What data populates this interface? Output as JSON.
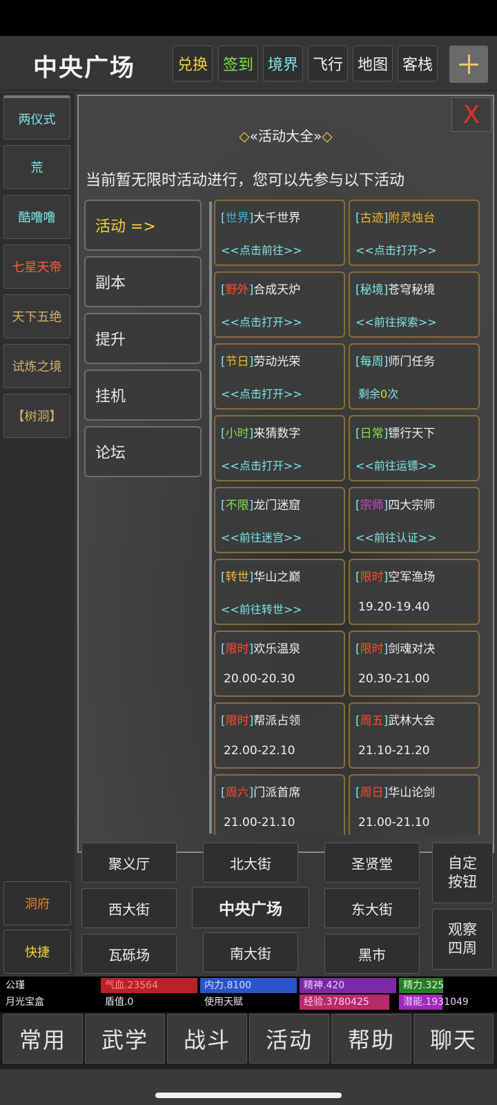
{
  "header": {
    "title": "中央广场",
    "buttons": [
      {
        "label": "兑换",
        "color": "#f2d23a"
      },
      {
        "label": "签到",
        "color": "#7ee24a"
      },
      {
        "label": "境界",
        "color": "#7fe6e6"
      },
      {
        "label": "飞行",
        "color": "#f0f0f0"
      },
      {
        "label": "地图",
        "color": "#f0f0f0"
      },
      {
        "label": "客栈",
        "color": "#f0f0f0"
      }
    ],
    "plus_icon": "plus-icon"
  },
  "sidebar": {
    "items": [
      {
        "label": "两仪式",
        "color": "#7fe6e6"
      },
      {
        "label": "荒",
        "color": "#7fe6e6"
      },
      {
        "label": "酷噜噜",
        "color": "#7fe6e6"
      },
      {
        "label": "七星天帝",
        "color": "#ff5a3a"
      },
      {
        "label": "天下五绝",
        "color": "#d8b06a"
      },
      {
        "label": "试炼之境",
        "color": "#d8b06a"
      },
      {
        "label": "【树洞】",
        "color": "#d8b06a"
      }
    ],
    "bottom": [
      {
        "label": "洞府",
        "color": "#e8842a"
      },
      {
        "label": "快捷",
        "color": "#f2d23a"
      }
    ]
  },
  "panel": {
    "close_label": "X",
    "title_left": "◇",
    "title": "«活动大全»",
    "title_right": "◇",
    "notice": "当前暂无限时活动进行，您可以先参与以下活动",
    "categories": [
      "活动 =>",
      "副本",
      "提升",
      "挂机",
      "论坛"
    ],
    "cards": [
      {
        "tag": "世界",
        "tag_color": "#3ab0e6",
        "name": "大千世界",
        "name_color": "#eeeeee",
        "action": "<<点击前往>>"
      },
      {
        "tag": "古迹",
        "tag_color": "#f0b830",
        "name": "附灵烛台",
        "name_color": "#f0b830",
        "action": "<<点击打开>>"
      },
      {
        "tag": "野外",
        "tag_color": "#ff4a2a",
        "name": "合成天炉",
        "name_color": "#eeeeee",
        "action": "<<点击打开>>"
      },
      {
        "tag": "秘境",
        "tag_color": "#7fe6e6",
        "name": "苍穹秘境",
        "name_color": "#eeeeee",
        "action": "<<前往探索>>"
      },
      {
        "tag": "节日",
        "tag_color": "#f0b830",
        "name": "劳动光荣",
        "name_color": "#eeeeee",
        "action": "<<点击打开>>"
      },
      {
        "tag": "每周",
        "tag_color": "#7fe6e6",
        "name": "师门任务",
        "name_color": "#eeeeee",
        "action_prefix": "剩余",
        "action_count": "0",
        "action_suffix": "次"
      },
      {
        "tag": "小时",
        "tag_color": "#7ee24a",
        "name": "来猜数字",
        "name_color": "#eeeeee",
        "action": "<<点击打开>>"
      },
      {
        "tag": "日常",
        "tag_color": "#7ee24a",
        "name": "镖行天下",
        "name_color": "#eeeeee",
        "action": "<<前往运镖>>"
      },
      {
        "tag": "不限",
        "tag_color": "#7ee24a",
        "name": "龙门迷窟",
        "name_color": "#eeeeee",
        "action": "<<前往迷宫>>"
      },
      {
        "tag": "宗师",
        "tag_color": "#d24ad2",
        "name": "四大宗师",
        "name_color": "#eeeeee",
        "action": "<<前往认证>>"
      },
      {
        "tag": "转世",
        "tag_color": "#f0b830",
        "name": "华山之巅",
        "name_color": "#eeeeee",
        "action": "<<前往转世>>"
      },
      {
        "tag": "限时",
        "tag_color": "#ff4a2a",
        "name": "空军渔场",
        "name_color": "#eeeeee",
        "time": "19.20-19.40"
      },
      {
        "tag": "限时",
        "tag_color": "#ff4a2a",
        "name": "欢乐温泉",
        "name_color": "#eeeeee",
        "time": "20.00-20.30"
      },
      {
        "tag": "限时",
        "tag_color": "#ff4a2a",
        "name": "剑魂对决",
        "name_color": "#eeeeee",
        "time": "20.30-21.00"
      },
      {
        "tag": "限时",
        "tag_color": "#ff4a2a",
        "name": "帮派占领",
        "name_color": "#eeeeee",
        "time": "22.00-22.10"
      },
      {
        "tag": "周五",
        "tag_color": "#ff4a2a",
        "name": "武林大会",
        "name_color": "#eeeeee",
        "time": "21.10-21.20"
      },
      {
        "tag": "周六",
        "tag_color": "#ff4a2a",
        "name": "门派首席",
        "name_color": "#eeeeee",
        "time": "21.00-21.10"
      },
      {
        "tag": "周日",
        "tag_color": "#ff4a2a",
        "name": "华山论剑",
        "name_color": "#eeeeee",
        "time": "21.00-21.10"
      }
    ]
  },
  "nav": {
    "row1": [
      "聚义厅",
      "北大街",
      "圣贤堂"
    ],
    "row2": [
      "西大街",
      "中央广场",
      "东大街"
    ],
    "row3": [
      "瓦砾场",
      "南大街",
      "黑市"
    ],
    "custom_line1": "自定",
    "custom_line2": "按钮",
    "observe_line1": "观察",
    "observe_line2": "四周"
  },
  "stats": {
    "name": "公瑾",
    "item": "月光宝盒",
    "hp": "气血.23564",
    "mp": "内力.8100",
    "spirit": "精神.420",
    "energy": "精力.325",
    "shield": "盾值.0",
    "talent": "使用天赋",
    "exp": "经验.3780425",
    "potential": "潜能.1931049",
    "exp_fill": 0.93,
    "potential_fill": 0.45
  },
  "tabs": [
    "常用",
    "武学",
    "战斗",
    "活动",
    "帮助",
    "聊天"
  ]
}
